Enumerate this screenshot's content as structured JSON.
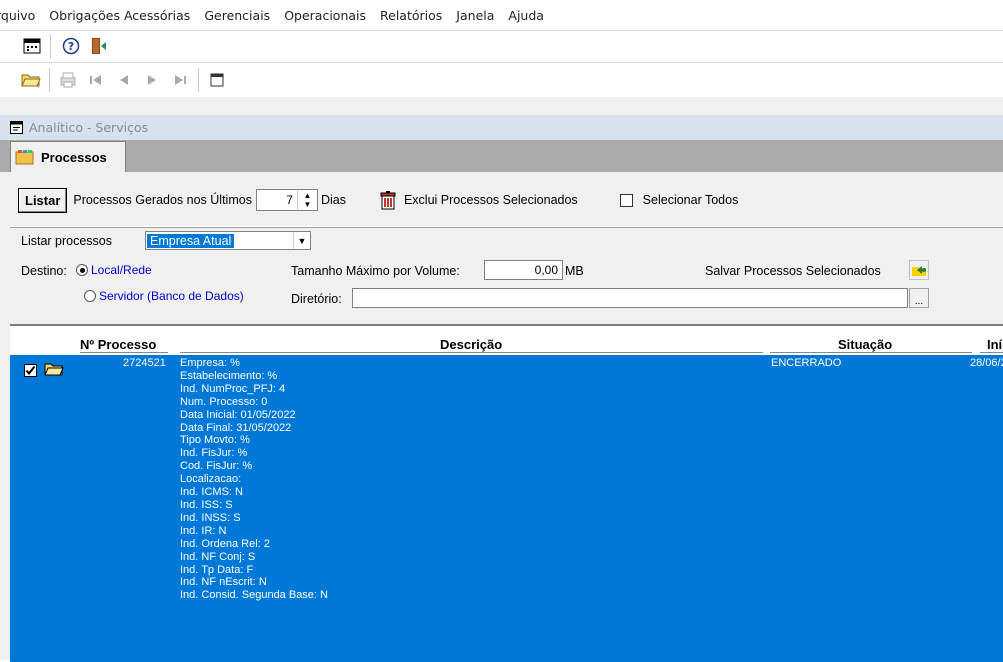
{
  "menu": [
    "rquivo",
    "Obrigações Acessórias",
    "Gerenciais",
    "Operacionais",
    "Relatórios",
    "Janela",
    "Ajuda"
  ],
  "icons": {
    "toolbar1": [
      "calendar-icon",
      "help-icon",
      "exit-door-icon"
    ],
    "toolbar2": [
      "open-folder-icon",
      "print-icon",
      "first-record-icon",
      "previous-record-icon",
      "next-record-icon",
      "last-record-icon",
      "window-icon"
    ]
  },
  "window": {
    "title": "Analítico - Serviços"
  },
  "tab": {
    "label": "Processos"
  },
  "controls": {
    "listar": "Listar",
    "gerados_label": "Processos Gerados nos Últimos",
    "dias_value": "7",
    "dias_label": "Dias",
    "exclui_label": "Exclui Processos Selecionados",
    "selecionar_todos": "Selecionar Todos"
  },
  "filter": {
    "listar_processos_label": "Listar processos",
    "listar_processos_value": "Empresa Atual",
    "destino_label": "Destino:",
    "destino_local": "Local/Rede",
    "destino_servidor": "Servidor (Banco de Dados)",
    "tamanho_label": "Tamanho Máximo por Volume:",
    "tamanho_value": "0,00",
    "tamanho_unit": "MB",
    "diretorio_label": "Diretório:",
    "diretorio_value": "",
    "browse": "...",
    "salvar_label": "Salvar Processos Selecionados"
  },
  "grid": {
    "columns": [
      "Nº Processo",
      "Descrição",
      "Situação",
      "Iní"
    ],
    "row": {
      "checked": true,
      "numero": "2724521",
      "descricao": [
        "Empresa: %",
        "Estabelecimento: %",
        "Ind. NumProc_PFJ: 4",
        "Num. Processo: 0",
        "Data Inicial: 01/05/2022",
        "Data Final: 31/05/2022",
        "Tipo Movto: %",
        "Ind. FisJur: %",
        "Cod. FisJur: %",
        "Localizacao:",
        "Ind. ICMS: N",
        "Ind. ISS: S",
        "Ind. INSS: S",
        "Ind. IR: N",
        "Ind. Ordena Rel: 2",
        "Ind. NF Conj: S",
        "Ind. Tp Data: F",
        "Ind. NF nEscrit: N",
        "Ind. Consid. Segunda Base: N"
      ],
      "situacao": "ENCERRADO",
      "inicio": "28/06/2"
    }
  },
  "colors": {
    "selection": "#0078d7",
    "mdi_title": "#d8e2ec",
    "tabstrip": "#ababab"
  }
}
